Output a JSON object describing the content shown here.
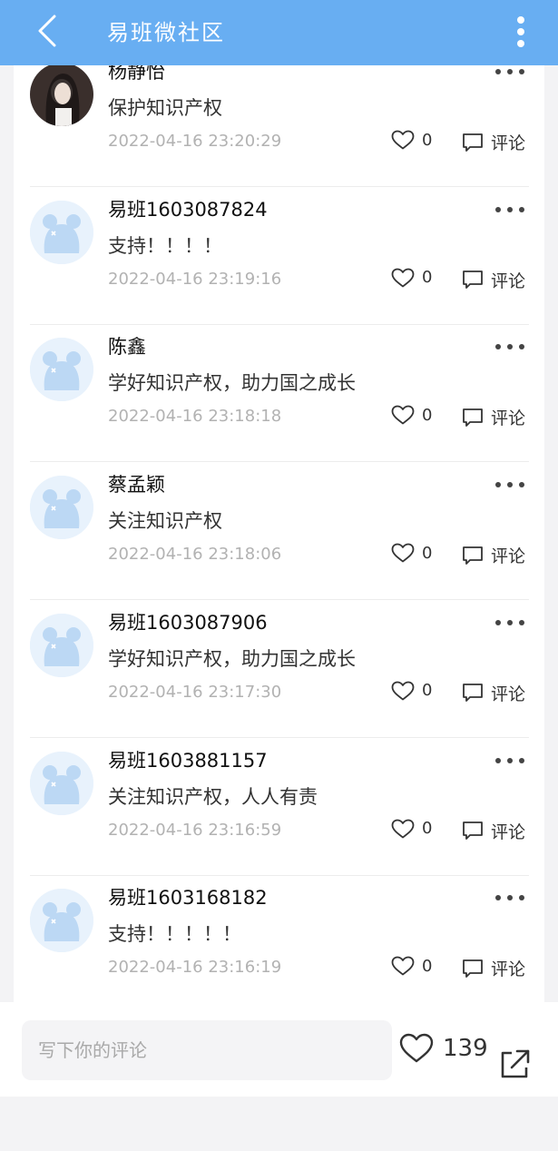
{
  "header": {
    "title": "易班微社区",
    "back_icon": "chevron-left-icon",
    "more_icon": "vertical-dots-icon",
    "background": "#68aef2"
  },
  "comments": [
    {
      "username": "杨静怡",
      "content": "保护知识产权",
      "timestamp": "2022-04-16 23:20:29",
      "likes": "0",
      "comment_label": "评论",
      "avatar": "photo"
    },
    {
      "username": "易班1603087824",
      "content": "支持！！！！",
      "timestamp": "2022-04-16 23:19:16",
      "likes": "0",
      "comment_label": "评论",
      "avatar": "default-bear"
    },
    {
      "username": "陈鑫",
      "content": "学好知识产权，助力国之成长",
      "timestamp": "2022-04-16 23:18:18",
      "likes": "0",
      "comment_label": "评论",
      "avatar": "default-bear"
    },
    {
      "username": "蔡孟颖",
      "content": "关注知识产权",
      "timestamp": "2022-04-16 23:18:06",
      "likes": "0",
      "comment_label": "评论",
      "avatar": "default-bear"
    },
    {
      "username": "易班1603087906",
      "content": "学好知识产权，助力国之成长",
      "timestamp": "2022-04-16 23:17:30",
      "likes": "0",
      "comment_label": "评论",
      "avatar": "default-bear"
    },
    {
      "username": "易班1603881157",
      "content": "关注知识产权，人人有责",
      "timestamp": "2022-04-16 23:16:59",
      "likes": "0",
      "comment_label": "评论",
      "avatar": "default-bear"
    },
    {
      "username": "易班1603168182",
      "content": "支持！！！！！",
      "timestamp": "2022-04-16 23:16:19",
      "likes": "0",
      "comment_label": "评论",
      "avatar": "default-bear"
    }
  ],
  "bottom_bar": {
    "input_placeholder": "写下你的评论",
    "total_likes": "139",
    "like_icon": "heart-icon",
    "share_icon": "share-icon"
  }
}
